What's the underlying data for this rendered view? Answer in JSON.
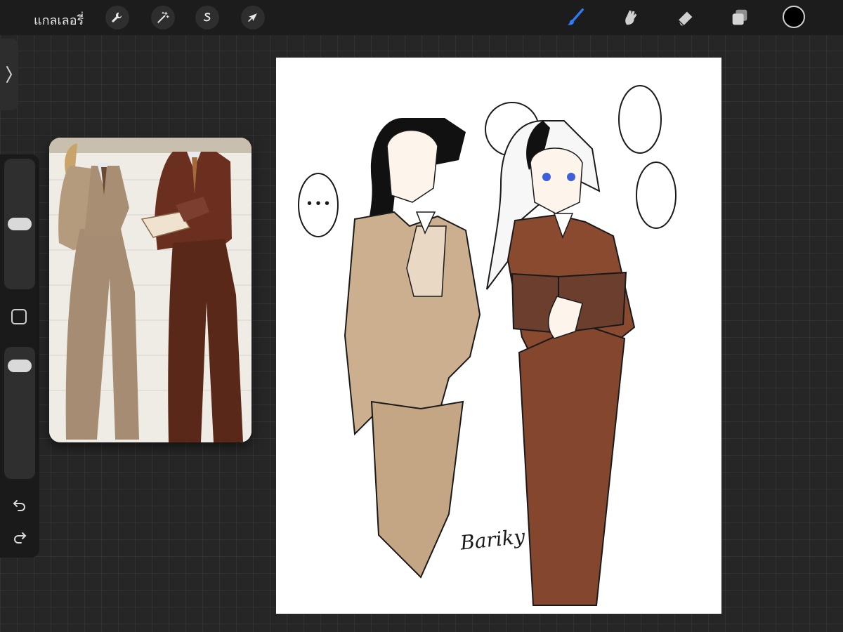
{
  "topbar": {
    "gallery_label": "แกลเลอรี่",
    "tools_left": [
      {
        "icon": "wrench-icon",
        "name": "actions"
      },
      {
        "icon": "magic-wand-icon",
        "name": "adjustments"
      },
      {
        "icon": "selection-s-icon",
        "name": "selection"
      },
      {
        "icon": "cursor-arrow-icon",
        "name": "transform"
      }
    ],
    "tools_right": [
      {
        "icon": "brush-icon",
        "name": "paint",
        "active": true
      },
      {
        "icon": "smudge-icon",
        "name": "smudge"
      },
      {
        "icon": "eraser-icon",
        "name": "eraser"
      },
      {
        "icon": "layers-icon",
        "name": "layers"
      }
    ],
    "current_color": "#000000",
    "active_color": "#2f7bf5"
  },
  "sidebar": {
    "brush_size_level": 0.5,
    "opacity_level": 0.92,
    "undo_icon": "undo-icon",
    "redo_icon": "redo-icon"
  },
  "artwork": {
    "signature": "Bariky",
    "speech_bubble_left": "• • •"
  },
  "colors": {
    "light_suit": "#c9ad8d",
    "dark_suit": "#8a4a30",
    "book": "#6b3e2e"
  }
}
